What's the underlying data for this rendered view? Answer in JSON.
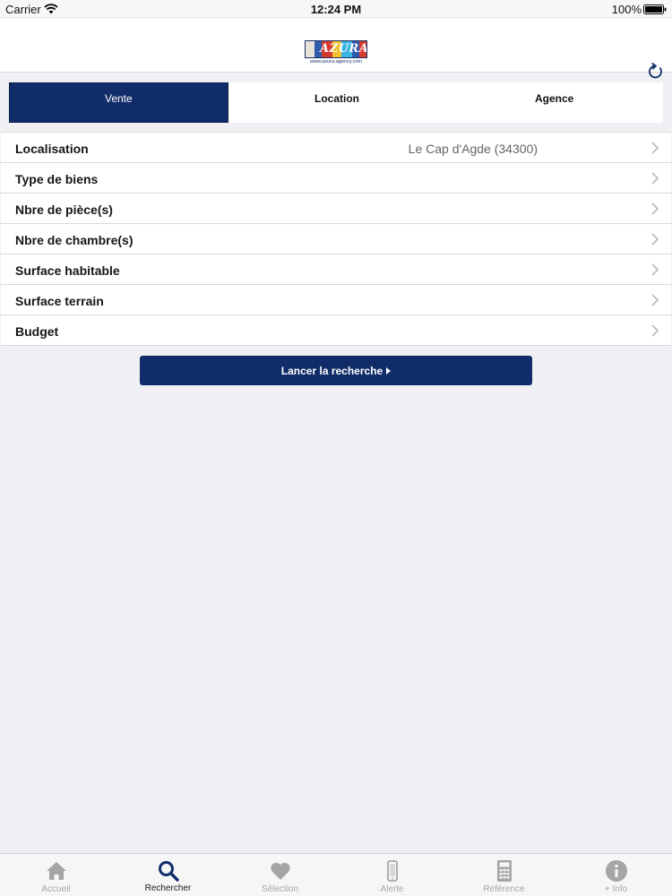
{
  "status_bar": {
    "carrier": "Carrier",
    "time": "12:24 PM",
    "battery": "100%"
  },
  "header": {
    "logo_text": "AZURA",
    "logo_url": "www.azura-agency.com",
    "icons": {
      "refresh": "refresh-icon"
    }
  },
  "segments": [
    {
      "label": "Vente",
      "active": true
    },
    {
      "label": "Location",
      "active": false
    },
    {
      "label": "Agence",
      "active": false
    }
  ],
  "criteria": [
    {
      "label": "Localisation",
      "value": "Le Cap d'Agde (34300)"
    },
    {
      "label": "Type de biens",
      "value": ""
    },
    {
      "label": "Nbre de pièce(s)",
      "value": ""
    },
    {
      "label": "Nbre de chambre(s)",
      "value": ""
    },
    {
      "label": "Surface habitable",
      "value": ""
    },
    {
      "label": "Surface terrain",
      "value": ""
    },
    {
      "label": "Budget",
      "value": ""
    }
  ],
  "search_button": {
    "label": "Lancer la recherche"
  },
  "tabs": [
    {
      "label": "Accueil",
      "icon": "home-icon",
      "active": false
    },
    {
      "label": "Rechercher",
      "icon": "search-icon",
      "active": true
    },
    {
      "label": "Sélection",
      "icon": "heart-icon",
      "active": false
    },
    {
      "label": "Alerte",
      "icon": "phone-icon",
      "active": false
    },
    {
      "label": "Référence",
      "icon": "calculator-icon",
      "active": false
    },
    {
      "label": "+ Info",
      "icon": "info-icon",
      "active": false
    }
  ],
  "colors": {
    "primary": "#112d69",
    "background": "#efeff4",
    "inactive_tab": "#a5a5a5",
    "value_text": "#666666"
  }
}
